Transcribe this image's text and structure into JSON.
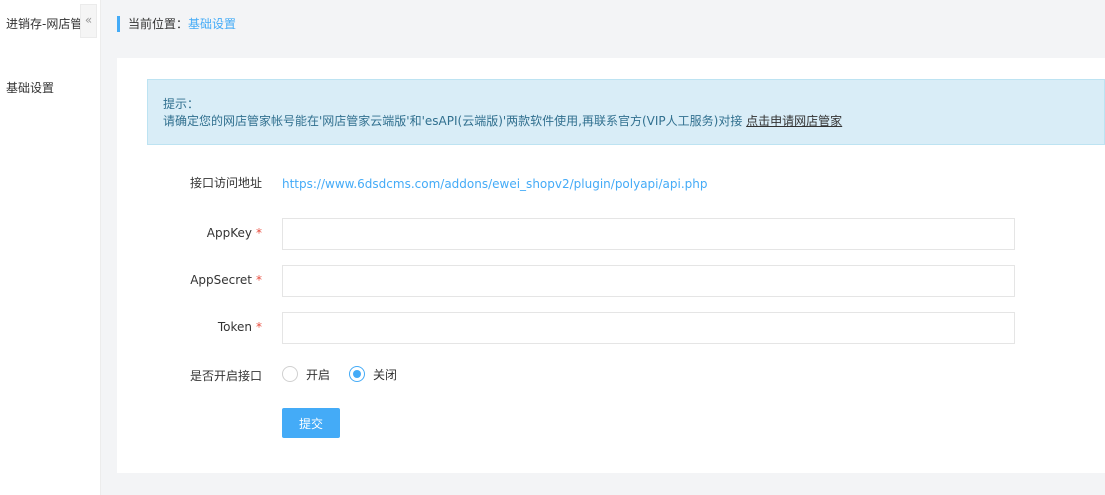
{
  "sidebar": {
    "title": "进销存-网店管家",
    "collapse_glyph": "«",
    "items": [
      {
        "label": "基础设置"
      }
    ]
  },
  "breadcrumb": {
    "prefix": "当前位置：",
    "current": "基础设置"
  },
  "tip": {
    "heading": "提示：",
    "message": "请确定您的网店管家帐号能在'网店管家云端版'和'esAPI(云端版)'两款软件使用,再联系官方(VIP人工服务)对接",
    "link_label": "点击申请网店管家"
  },
  "form": {
    "api_url_label": "接口访问地址",
    "api_url": "https://www.6dsdcms.com/addons/ewei_shopv2/plugin/polyapi/api.php",
    "appkey_label": "AppKey",
    "appkey_value": "",
    "appsecret_label": "AppSecret",
    "appsecret_value": "",
    "token_label": "Token",
    "token_value": "",
    "required_mark": "*",
    "enable_label": "是否开启接口",
    "enable_options": [
      {
        "label": "开启",
        "checked": false
      },
      {
        "label": "关闭",
        "checked": true
      }
    ],
    "submit_label": "提交"
  },
  "colors": {
    "accent": "#44abf7",
    "tip_bg": "#d9edf7",
    "tip_text": "#31708f",
    "required": "#e84c3d"
  }
}
